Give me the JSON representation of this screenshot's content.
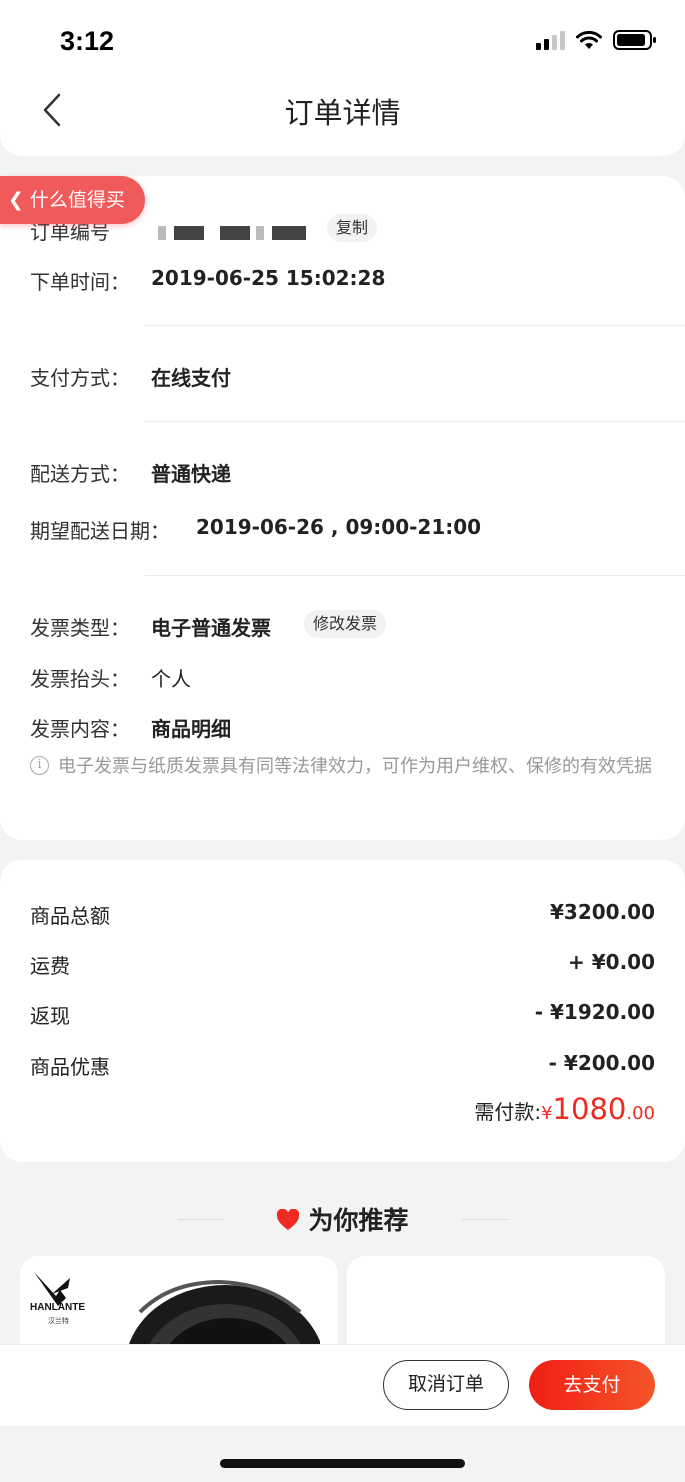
{
  "status_bar": {
    "time": "3:12"
  },
  "nav": {
    "title": "订单详情"
  },
  "badge": {
    "label": "什么值得买"
  },
  "order": {
    "number_label": "订单编号",
    "copy_label": "复制",
    "time_label": "下单时间：",
    "time_value": "2019-06-25 15:02:28",
    "payment_label": "支付方式：",
    "payment_value": "在线支付",
    "delivery_label": "配送方式：",
    "delivery_value": "普通快递",
    "expected_label": "期望配送日期：",
    "expected_value": "2019-06-26 , 09:00-21:00",
    "invoice_type_label": "发票类型：",
    "invoice_type_value": "电子普通发票",
    "modify_invoice_label": "修改发票",
    "invoice_header_label": "发票抬头：",
    "invoice_header_value": "个人",
    "invoice_content_label": "发票内容：",
    "invoice_content_value": "商品明细",
    "invoice_note": "电子发票与纸质发票具有同等法律效力，可作为用户维权、保修的有效凭据"
  },
  "amounts": {
    "subtotal_label": "商品总额",
    "subtotal_value": "¥3200.00",
    "shipping_label": "运费",
    "shipping_value": "+ ¥0.00",
    "cashback_label": "返现",
    "cashback_value": "- ¥1920.00",
    "discount_label": "商品优惠",
    "discount_value": "- ¥200.00",
    "payable_label": "需付款:",
    "payable_currency": "¥",
    "payable_int": "1080",
    "payable_dec": ".00"
  },
  "recommend": {
    "title": "为你推荐",
    "brand_name": "HANLANTE",
    "brand_sub": "汉兰特"
  },
  "actions": {
    "cancel_label": "取消订单",
    "pay_label": "去支付"
  },
  "colors": {
    "accent": "#ee2a22",
    "badge": "#f05a5a"
  }
}
